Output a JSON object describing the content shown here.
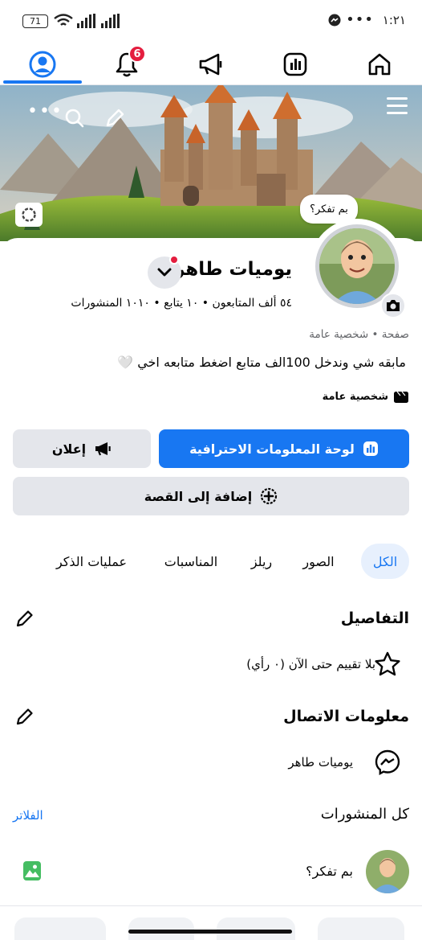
{
  "status_bar": {
    "time": "١:٢١",
    "battery": "71"
  },
  "nav": {
    "notifications_count": "6"
  },
  "cover": {
    "thought_bubble": "بم تفكر؟"
  },
  "profile": {
    "name": "يوميات طاهر",
    "stats": "٥٤ ألف المتابعون • ١٠ يتابع • ١٠١٠ المنشورات",
    "category": "صفحة • شخصية عامة",
    "bio": "مابقه شي وندخل 100الف متابع اضغط متابعه اخي 🤍",
    "public_figure": "شخصية عامة"
  },
  "buttons": {
    "dashboard": "لوحة المعلومات الاحترافية",
    "advertise": "إعلان",
    "add_story": "إضافة إلى القصة"
  },
  "tabs": [
    "الكل",
    "الصور",
    "ريلز",
    "المناسبات",
    "عمليات الذكر"
  ],
  "details": {
    "title": "التفاصيل",
    "rating": "بلا تقييم حتى الآن (٠ رأي)"
  },
  "contact": {
    "title": "معلومات الاتصال",
    "messenger": "يوميات طاهر"
  },
  "posts": {
    "title": "كل المنشورات",
    "filters": "الفلاتر",
    "composer_prompt": "بم تفكر؟"
  },
  "colors": {
    "accent": "#1877f2",
    "badge": "#e41e3f",
    "secondary_btn": "#e4e6eb"
  }
}
